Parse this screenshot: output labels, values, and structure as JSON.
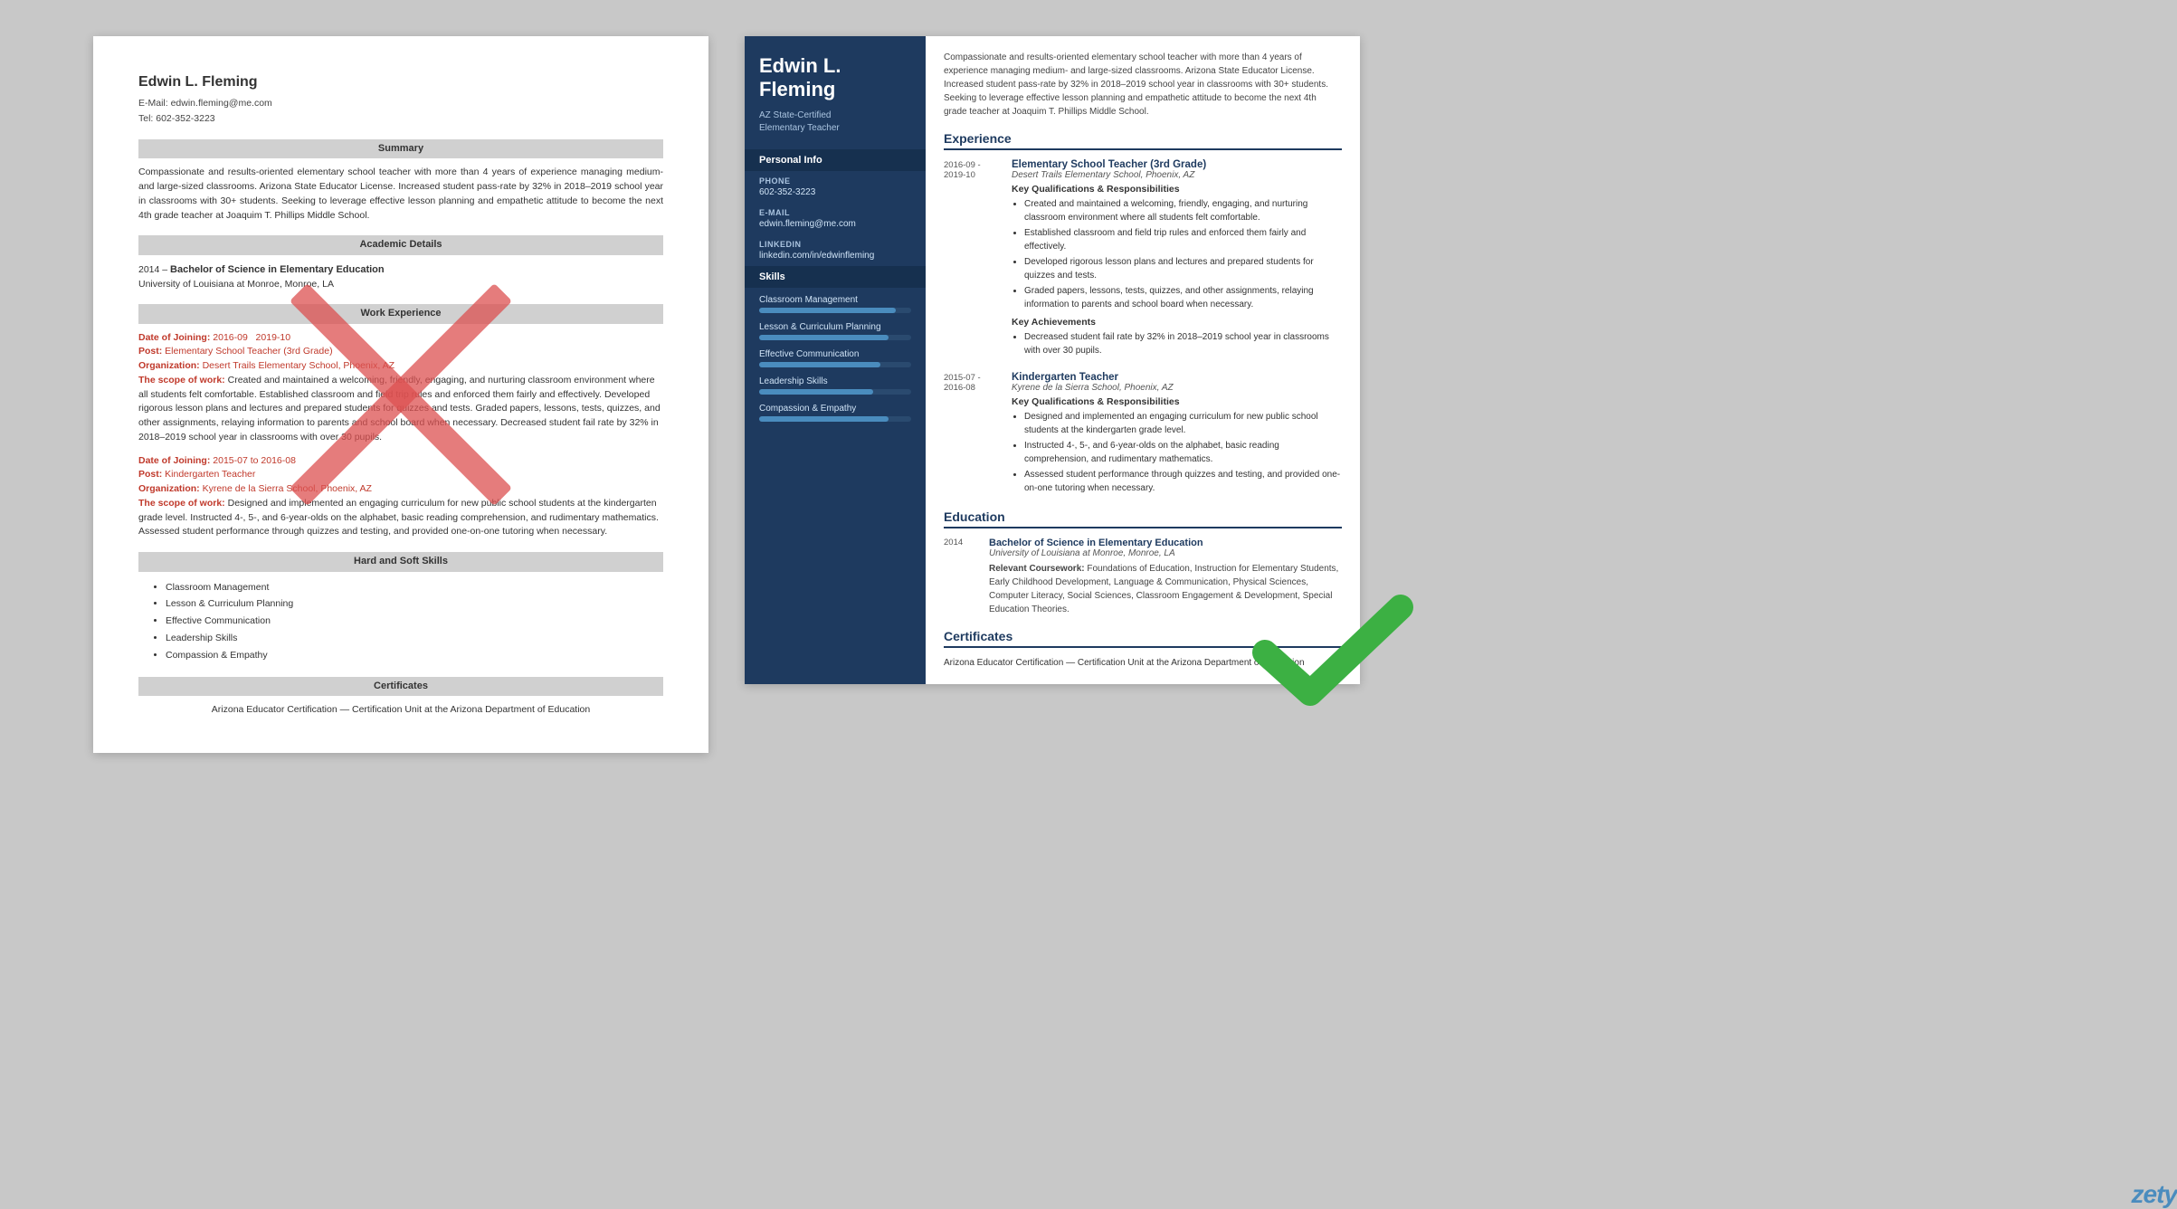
{
  "leftResume": {
    "name": "Edwin L. Fleming",
    "email": "E-Mail: edwin.fleming@me.com",
    "tel": "Tel: 602-352-3223",
    "sections": {
      "summary": {
        "header": "Summary",
        "text": "Compassionate and results-oriented elementary school teacher with more than 4 years of experience managing medium- and large-sized classrooms. Arizona State Educator License. Increased student pass-rate by 32% in 2018–2019 school year in classrooms with 30+ students. Seeking to leverage effective lesson planning and empathetic attitude to become the next 4th grade teacher at Joaquim T. Phillips Middle School."
      },
      "academic": {
        "header": "Academic Details",
        "year": "2014 –",
        "degree": "Bachelor of Science in Elementary Education",
        "school": "University of Louisiana at Monroe, Monroe, LA"
      },
      "work": {
        "header": "Work Experience",
        "entries": [
          {
            "dateLabel": "Date of Joining:",
            "date": "2016-09   2019-10",
            "postLabel": "Post:",
            "post": "Elementary School Teacher (3rd Grade)",
            "orgLabel": "Organization:",
            "org": "Desert Trails Elementary School, Phoenix, AZ",
            "scopeLabel": "The scope of work:",
            "scope": "Created and maintained a welcoming, friendly, engaging, and nurturing classroom environment where all students felt comfortable. Established classroom and field trip rules and enforced them fairly and effectively. Developed rigorous lesson plans and lectures and prepared students for quizzes and tests. Graded papers, lessons, tests, quizzes, and other assignments, relaying information to parents and school board when necessary. Decreased student fail rate by 32% in 2018–2019 school year in classrooms with over 30 pupils."
          },
          {
            "dateLabel": "Date of Joining:",
            "date": "2015-07 to 2016-08",
            "postLabel": "Post:",
            "post": "Kindergarten Teacher",
            "orgLabel": "Organization:",
            "org": "Kyrene de la Sierra School, Phoenix, AZ",
            "scopeLabel": "The scope of work:",
            "scope": "Designed and implemented an engaging curriculum for new public school students at the kindergarten grade level. Instructed 4-, 5-, and 6-year-olds on the alphabet, basic reading comprehension, and rudimentary mathematics. Assessed student performance through quizzes and testing, and provided one-on-one tutoring when necessary."
          }
        ]
      },
      "skills": {
        "header": "Hard and Soft Skills",
        "items": [
          "Classroom Management",
          "Lesson & Curriculum Planning",
          "Effective Communication",
          "Leadership Skills",
          "Compassion & Empathy"
        ]
      },
      "certificates": {
        "header": "Certificates",
        "text": "Arizona Educator Certification — Certification Unit at the Arizona Department of Education"
      }
    }
  },
  "rightResume": {
    "name": "Edwin L. Fleming",
    "certLine1": "AZ State-Certified",
    "certLine2": "Elementary Teacher",
    "summary": "Compassionate and results-oriented elementary school teacher with more than 4 years of experience managing medium- and large-sized classrooms. Arizona State Educator License. Increased student pass-rate by 32% in 2018–2019 school year in classrooms with 30+ students. Seeking to leverage effective lesson planning and empathetic attitude to become the next 4th grade teacher at Joaquim T. Phillips Middle School.",
    "sidebar": {
      "personalInfo": "Personal Info",
      "phoneLabel": "Phone",
      "phone": "602-352-3223",
      "emailLabel": "E-mail",
      "email": "edwin.fleming@me.com",
      "linkedinLabel": "LinkedIn",
      "linkedin": "linkedin.com/in/edwinfleming",
      "skillsTitle": "Skills",
      "skills": [
        {
          "label": "Classroom Management",
          "pct": 90
        },
        {
          "label": "Lesson & Curriculum Planning",
          "pct": 85
        },
        {
          "label": "Effective Communication",
          "pct": 80
        },
        {
          "label": "Leadership Skills",
          "pct": 75
        },
        {
          "label": "Compassion & Empathy",
          "pct": 85
        }
      ]
    },
    "experience": {
      "title": "Experience",
      "entries": [
        {
          "dateStart": "2016-09 -",
          "dateEnd": "2019-10",
          "jobTitle": "Elementary School Teacher (3rd Grade)",
          "org": "Desert Trails Elementary School, Phoenix, AZ",
          "qualTitle": "Key Qualifications & Responsibilities",
          "quals": [
            "Created and maintained a welcoming, friendly, engaging, and nurturing classroom environment where all students felt comfortable.",
            "Established classroom and field trip rules and enforced them fairly and effectively.",
            "Developed rigorous lesson plans and lectures and prepared students for quizzes and tests.",
            "Graded papers, lessons, tests, quizzes, and other assignments, relaying information to parents and school board when necessary."
          ],
          "achieveTitle": "Key Achievements",
          "achievements": [
            "Decreased student fail rate by 32% in 2018–2019 school year in classrooms with over 30 pupils."
          ]
        },
        {
          "dateStart": "2015-07 -",
          "dateEnd": "2016-08",
          "jobTitle": "Kindergarten Teacher",
          "org": "Kyrene de la Sierra School, Phoenix, AZ",
          "qualTitle": "Key Qualifications & Responsibilities",
          "quals": [
            "Designed and implemented an engaging curriculum for new public school students at the kindergarten grade level.",
            "Instructed 4-, 5-, and 6-year-olds on the alphabet, basic reading comprehension, and rudimentary mathematics.",
            "Assessed student performance through quizzes and testing, and provided one-on-one tutoring when necessary."
          ]
        }
      ]
    },
    "education": {
      "title": "Education",
      "entries": [
        {
          "year": "2014",
          "degree": "Bachelor of Science in Elementary Education",
          "school": "University of Louisiana at Monroe, Monroe, LA",
          "coursework": "Relevant Coursework: Foundations of Education, Instruction for Elementary Students, Early Childhood Development, Language & Communication, Physical Sciences, Computer Literacy, Social Sciences, Classroom Engagement & Development, Special Education Theories."
        }
      ]
    },
    "certificates": {
      "title": "Certificates",
      "text": "Arizona Educator Certification — Certification Unit at the Arizona Department of Education"
    }
  },
  "zety": "zety"
}
